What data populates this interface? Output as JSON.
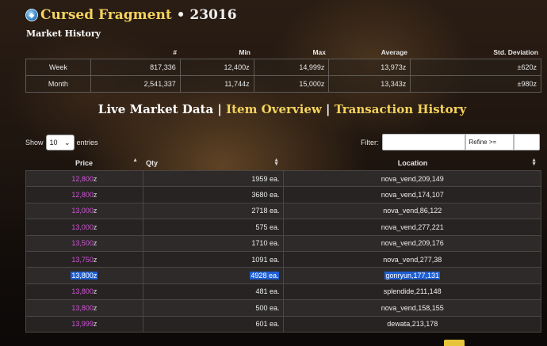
{
  "header": {
    "item_name": "Cursed Fragment",
    "separator": " • ",
    "item_id": "23016",
    "icon": "blue-orb-icon"
  },
  "history": {
    "title": "Market History",
    "columns": [
      "",
      "#",
      "Min",
      "Max",
      "Average",
      "Std. Deviation"
    ],
    "rows": [
      {
        "label": "Week",
        "count": "817,336",
        "min": "12,400z",
        "max": "14,999z",
        "avg": "13,973z",
        "std": "±620z"
      },
      {
        "label": "Month",
        "count": "2,541,337",
        "min": "11,744z",
        "max": "15,000z",
        "avg": "13,343z",
        "std": "±980z"
      }
    ]
  },
  "tabs": {
    "live": "Live Market Data",
    "sep": " | ",
    "overview": "Item Overview",
    "transactions": "Transaction History"
  },
  "controls": {
    "show_label": "Show",
    "entries_value": "10",
    "entries_label": "entries",
    "filter_label": "Filter:",
    "refine_label": "Refine >="
  },
  "market": {
    "columns": [
      "Price",
      "Qty",
      "Location"
    ],
    "rows": [
      {
        "price": "12,800",
        "qty": "1959 ea.",
        "location": "nova_vend,209,149"
      },
      {
        "price": "12,800",
        "qty": "3680 ea.",
        "location": "nova_vend,174,107"
      },
      {
        "price": "13,000",
        "qty": "2718 ea.",
        "location": "nova_vend,86,122"
      },
      {
        "price": "13,000",
        "qty": "575 ea.",
        "location": "nova_vend,277,221"
      },
      {
        "price": "13,500",
        "qty": "1710 ea.",
        "location": "nova_vend,209,176"
      },
      {
        "price": "13,750",
        "qty": "1091 ea.",
        "location": "nova_vend,277,38"
      },
      {
        "price": "13,800",
        "qty": "4928 ea.",
        "location": "gonryun,177,131"
      },
      {
        "price": "13,800",
        "qty": "481 ea.",
        "location": "splendide,211,148"
      },
      {
        "price": "13,800",
        "qty": "500 ea.",
        "location": "nova_vend,158,155"
      },
      {
        "price": "13,999",
        "qty": "601 ea.",
        "location": "dewata,213,178"
      }
    ],
    "currency_suffix": "z"
  },
  "colors": {
    "accent_gold": "#f4d35e",
    "price_magenta": "#d054d6",
    "selection_blue": "#1e5fd3"
  }
}
